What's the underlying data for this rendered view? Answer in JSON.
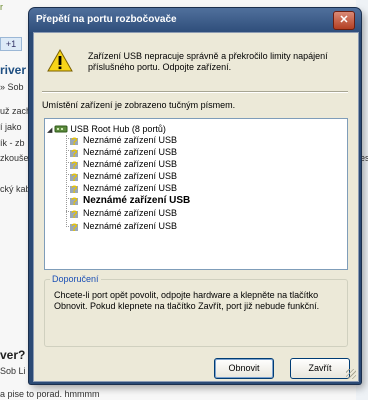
{
  "background_page": {
    "top_text": "r",
    "gplus_label": "+1",
    "heading1": "river",
    "crumb": "» Sob",
    "snippets": [
      "už zach",
      "í jako",
      "ík - zb",
      "zkouše",
      "cký kab"
    ],
    "right_snippet": "es",
    "heading2": "ver?",
    "crumb2": "Sob Li",
    "footer": "a pise to porad. hmmmm"
  },
  "dialog": {
    "title": "Přepětí na portu rozbočovače",
    "close_label": "✕",
    "message": "Zařízení USB nepracuje správně a překročilo limity napájení příslušného portu. Odpojte zařízení.",
    "info": "Umístění zařízení je zobrazeno tučným písmem.",
    "tree": {
      "root_label": "USB Root Hub (8 portů)",
      "children": [
        {
          "label": "Neznámé zařízení USB",
          "bold": false
        },
        {
          "label": "Neznámé zařízení USB",
          "bold": false
        },
        {
          "label": "Neznámé zařízení USB",
          "bold": false
        },
        {
          "label": "Neznámé zařízení USB",
          "bold": false
        },
        {
          "label": "Neznámé zařízení USB",
          "bold": false
        },
        {
          "label": "Neznámé zařízení USB",
          "bold": true
        },
        {
          "label": "Neznámé zařízení USB",
          "bold": false
        },
        {
          "label": "Neznámé zařízení USB",
          "bold": false
        }
      ]
    },
    "recommendation": {
      "label": "Doporučení",
      "text": "Chcete-li port opět povolit, odpojte hardware a klepněte na tlačítko Obnovit. Pokud klepnete na tlačítko Zavřít, port již nebude funkční."
    },
    "buttons": {
      "refresh": "Obnovit",
      "close": "Zavřít"
    }
  }
}
